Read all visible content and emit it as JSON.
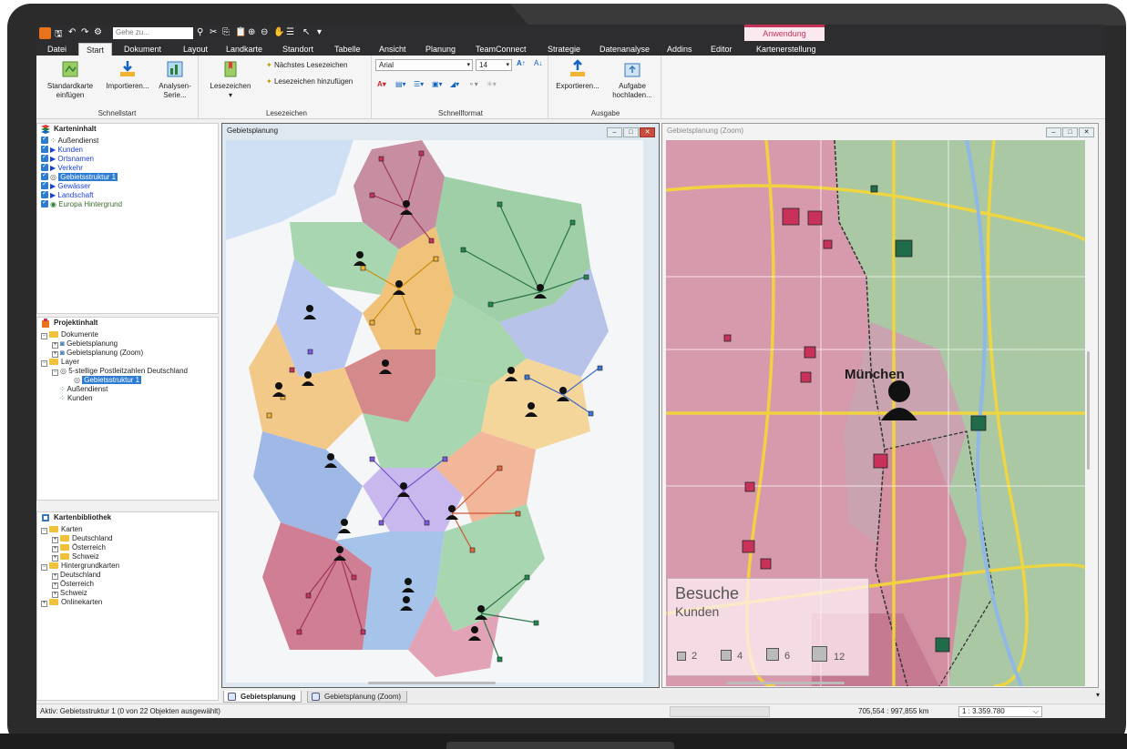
{
  "quick_access": {
    "search_placeholder": "Gehe zu..."
  },
  "context_tab": {
    "label": "Anwendung"
  },
  "tabs": [
    "Datei",
    "Start",
    "Dokument",
    "Layout",
    "Landkarte",
    "Standort",
    "Tabelle",
    "Ansicht",
    "Planung",
    "TeamConnect",
    "Strategie",
    "Datenanalyse",
    "Addins",
    "Editor",
    "Kartenerstellung"
  ],
  "active_tab": "Start",
  "ribbon": {
    "schnellstart": {
      "label": "Schnellstart",
      "btn1": [
        "Standardkarte",
        "einfügen"
      ],
      "btn2": [
        "Importieren..."
      ],
      "btn3": [
        "Analysen-",
        "Serie..."
      ]
    },
    "lesezeichen": {
      "label": "Lesezeichen",
      "btn_main": "Lesezeichen",
      "next": "Nächstes Lesezeichen",
      "add": "Lesezeichen hinzufügen"
    },
    "schnellformat": {
      "label": "Schnellformat",
      "font": "Arial",
      "size": "14"
    },
    "ausgabe": {
      "label": "Ausgabe",
      "export": "Exportieren...",
      "upload": [
        "Aufgabe",
        "hochladen..."
      ]
    }
  },
  "kartenininhalt": {
    "title": "Karteninhalt",
    "items": [
      "Außendienst",
      "Kunden",
      "Ortsnamen",
      "Verkehr",
      "Gebietsstruktur 1",
      "Gewässer",
      "Landschaft",
      "Europa Hintergrund"
    ]
  },
  "projektinhalt": {
    "title": "Projektinhalt",
    "dokumente": "Dokumente",
    "doc1": "Gebietsplanung",
    "doc2": "Gebietsplanung (Zoom)",
    "layer": "Layer",
    "plz": "5-stellige Postleitzahlen Deutschland",
    "struktur": "Gebietsstruktur 1",
    "aussendienst": "Außendienst",
    "kunden": "Kunden"
  },
  "kartenbibliothek": {
    "title": "Kartenbibliothek",
    "karten": "Karten",
    "de": "Deutschland",
    "at": "Österreich",
    "ch": "Schweiz",
    "hintergrund": "Hintergrundkarten",
    "hde": "Deutschland",
    "hat": "Österreich",
    "hch": "Schweiz",
    "online": "Onlinekarten"
  },
  "map_main": {
    "title": "Gebietsplanung"
  },
  "map_zoom": {
    "title": "Gebietsplanung (Zoom)",
    "city": "München",
    "legend": {
      "title": "Besuche",
      "subtitle": "Kunden",
      "values": [
        "2",
        "4",
        "6",
        "12"
      ]
    }
  },
  "doc_tabs": [
    "Gebietsplanung",
    "Gebietsplanung (Zoom)"
  ],
  "status": {
    "active": "Aktiv: Gebietsstruktur 1 (0 von 22 Objekten ausgewählt)",
    "coords": "705,554 : 997,855 km",
    "scale": "1 : 3.359.780"
  },
  "colors": {
    "accent": "#c8325a",
    "ribbon_dark": "#2d2d30",
    "selection": "#2c7cd3"
  }
}
